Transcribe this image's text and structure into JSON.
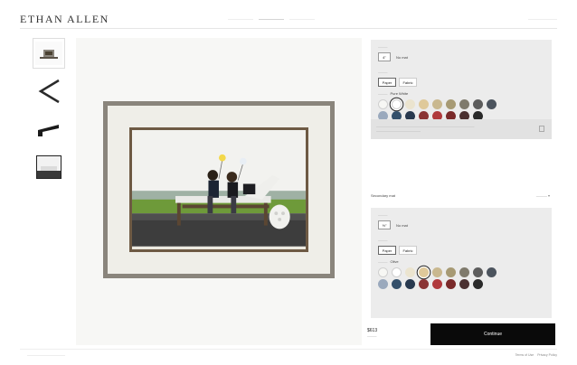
{
  "header": {
    "logo": "ETHAN ALLEN"
  },
  "mat1": {
    "width_value": "4\"",
    "no_mat_label": "No mat",
    "type_options": [
      "Paper",
      "Fabric"
    ],
    "color_value": "Pure White",
    "swatches": [
      "#f7f7f4",
      "#ffffff",
      "#ebe4cf",
      "#dfc99a",
      "#c9b88f",
      "#a79a74",
      "#7f7a6c",
      "#5c5c5c",
      "#4c545e",
      "#9aa9bd",
      "#34506b",
      "#28394f",
      "#8a3434",
      "#b0393c",
      "#7a2a2a",
      "#4a3030",
      "#2a2a2a"
    ],
    "selected_index": 1
  },
  "mat2": {
    "section_label": "Secondary mat",
    "width_value": "½\"",
    "no_mat_label": "No mat",
    "type_options": [
      "Paper",
      "Fabric"
    ],
    "color_value": "Olive",
    "swatches": [
      "#f7f7f4",
      "#ffffff",
      "#ebe4cf",
      "#dfc99a",
      "#c9b88f",
      "#a79a74",
      "#7f7a6c",
      "#5c5c5c",
      "#4c545e",
      "#9aa9bd",
      "#34506b",
      "#28394f",
      "#8a3434",
      "#b0393c",
      "#7a2a2a",
      "#4a3030",
      "#2a2a2a"
    ],
    "selected_index": 3
  },
  "order": {
    "price": "$613",
    "continue_label": "Continue"
  },
  "footer": {
    "links": [
      "Terms of Use",
      "Privacy Policy"
    ]
  }
}
